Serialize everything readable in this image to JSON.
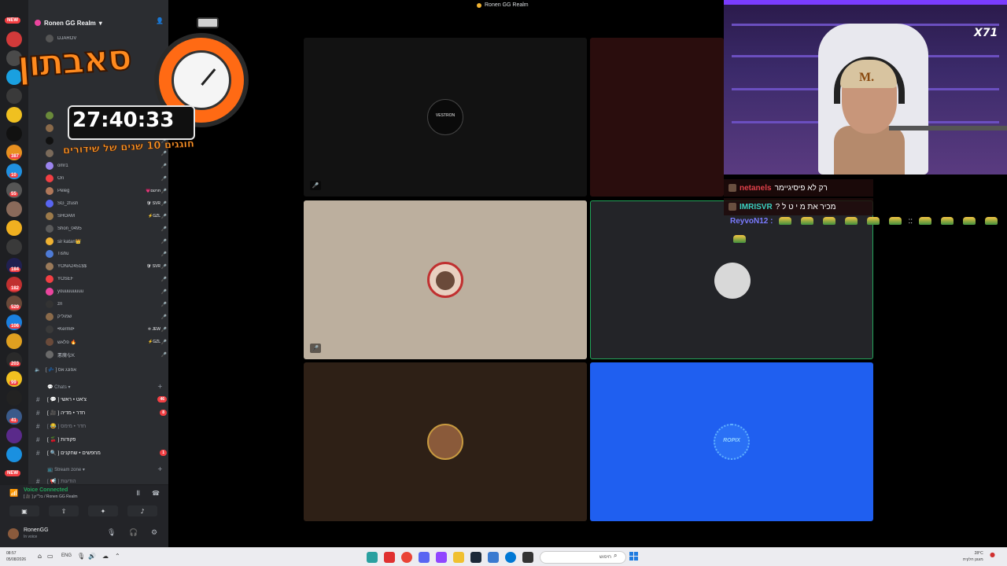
{
  "window": {
    "title": "Ronen GG Realm"
  },
  "server": {
    "name": "Ronen GG Realm"
  },
  "overlay": {
    "subathon_title": "סאבתון",
    "timer": "27:40:33",
    "subtitle": "חוגגים 10 שנים של שידורים",
    "cam_logo": "X71"
  },
  "voice_users_partial": {
    "top": "DJAROV"
  },
  "voice_users": [
    {
      "name": "omr1",
      "tag": "",
      "color": "#9b84ee"
    },
    {
      "name": "Ori",
      "tag": "",
      "color": "#f23f43"
    },
    {
      "name": "Peleg",
      "tag": "💗חרטם",
      "color": "#b0785a"
    },
    {
      "name": "SG_zfush",
      "tag": "🛡 SVR",
      "color": "#5865f2"
    },
    {
      "name": "SHOAM",
      "tag": "⚡GZL",
      "color": "#9c7a4a"
    },
    {
      "name": "Shon_0495",
      "tag": "",
      "color": "#5a5a5a"
    },
    {
      "name": "sir katan👑",
      "tag": "",
      "color": "#f0b232"
    },
    {
      "name": "Tishu",
      "tag": "",
      "color": "#4e7bd6"
    },
    {
      "name": "YONA2451$$",
      "tag": "🛡 SVR",
      "color": "#9a7a5a"
    },
    {
      "name": "YOSEF",
      "tag": "",
      "color": "#f23f43"
    },
    {
      "name": "youuuuuuuu",
      "tag": "",
      "color": "#eb459e"
    },
    {
      "name": "zri",
      "tag": "",
      "color": "#333333"
    },
    {
      "name": "שמוליק",
      "tag": "",
      "color": "#8a6a4a"
    },
    {
      "name": "•Kermit•",
      "tag": "✡ JEW",
      "color": "#3a3a3a"
    },
    {
      "name": "פלאש 🔥",
      "tag": "⚡GZL",
      "color": "#6a4a3a"
    },
    {
      "name": "悪魔なK",
      "tag": "",
      "color": "#6a6a6a"
    }
  ],
  "voice_channel_afk": "[ 💤 ] אפונג אס",
  "categories": {
    "chats": "Chats",
    "stream_zone": "Stream zone"
  },
  "channels": [
    {
      "name": "[ 💬 ] צ'אט • ראשי",
      "badge": "46",
      "dim": false
    },
    {
      "name": "[ 🎥 ] חדר • מדיה",
      "badge": "8",
      "dim": false
    },
    {
      "name": "[ 😂 ] חדר • מימס",
      "badge": "",
      "dim": true
    },
    {
      "name": "[ 🍒 ] פקודות",
      "badge": "",
      "dim": false
    },
    {
      "name": "[ 🔍 ] מחפשים • שחקנים",
      "badge": "1",
      "dim": false
    }
  ],
  "channel_partial": "[ 📢 ] הודעות",
  "voice_panel": {
    "status": "Voice Connected",
    "channel": "[ 🎥 ] בל״ק / Ronen GG Realm"
  },
  "user_panel": {
    "name": "RonenGG",
    "status": "In voice"
  },
  "rail_badges": [
    "4",
    "387",
    "10",
    "55",
    "184",
    "182",
    "520",
    "106",
    "203",
    "99",
    "41"
  ],
  "rail_new": "NEW",
  "chat": [
    {
      "user": "netanels",
      "user_color": "#e0404a",
      "text": "רק לא פיסיגיימר"
    },
    {
      "user": "IMRISVR",
      "user_color": "#3ad0c0",
      "text": "מכיר את מ י ט ל ?"
    },
    {
      "user": "ReyvoN12 :",
      "user_color": "#7a7aff",
      "text": "::"
    }
  ],
  "tiles": [
    {
      "name": "tile-vestron",
      "bg": "#121212",
      "logo": "VESTRON"
    },
    {
      "name": "tile-red",
      "bg": "#2a0d0d",
      "logo": ""
    },
    {
      "name": "tile-beige",
      "bg": "#bcaf9e",
      "logo": ""
    },
    {
      "name": "tile-grey",
      "bg": "#232428",
      "logo": ""
    },
    {
      "name": "tile-brown",
      "bg": "#2e2016",
      "logo": ""
    },
    {
      "name": "tile-blue",
      "bg": "#1f5ff0",
      "logo": "ROPIX"
    }
  ],
  "taskbar": {
    "time": "08:57",
    "date": "05/08/2026",
    "lang": "ENG",
    "search_placeholder": "חיפוש",
    "weather_temp": "28°C",
    "weather_desc": "מעונן חלקית"
  },
  "colors": {
    "discord_bg": "#2b2d31",
    "rail_bg": "#1e1f22",
    "accent_green": "#23a55a",
    "notify_red": "#f23f43"
  }
}
